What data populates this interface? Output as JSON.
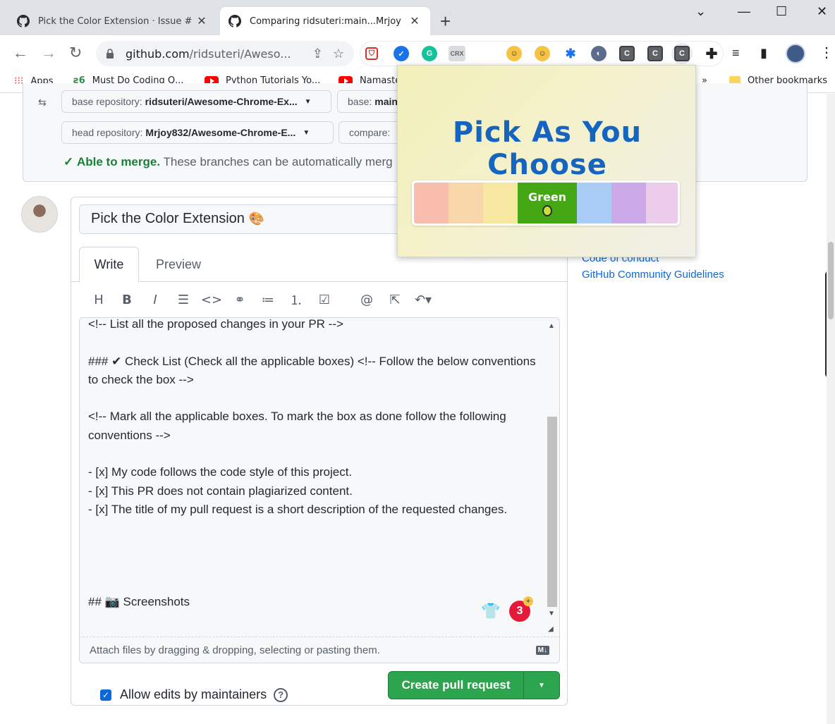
{
  "browser": {
    "tabs": [
      {
        "label": "Pick the Color Extension · Issue #",
        "active": false
      },
      {
        "label": "Comparing ridsuteri:main...Mrjoy",
        "active": true
      }
    ],
    "url_domain": "github.com",
    "url_path": "/ridsuteri/Aweso...",
    "bookmarks": {
      "apps": "Apps",
      "must_do": "Must Do Coding Q...",
      "python": "Python Tutorials Yo...",
      "namaste": "Namaste",
      "overflow": "»",
      "other": "Other bookmarks"
    },
    "ext_crx": "CRX",
    "ext_c": "C"
  },
  "compare": {
    "base_repo_label": "base repository:",
    "base_repo_value": "ridsuteri/Awesome-Chrome-Ex...",
    "base_label": "base:",
    "base_value": "main",
    "head_repo_label": "head repository:",
    "head_repo_value": "Mrjoy832/Awesome-Chrome-E...",
    "compare_label": "compare:",
    "merge_ok": "Able to merge.",
    "merge_text": "These branches can be automatically merg"
  },
  "form": {
    "title_value": "Pick the Color Extension",
    "tab_write": "Write",
    "tab_preview": "Preview",
    "body_lines": [
      "<!-- List all the proposed changes in your PR -->",
      "",
      "### ✔ Check List (Check all the applicable boxes) <!-- Follow the below conventions to check the box -->",
      "",
      "<!-- Mark all the applicable boxes. To mark the box as done follow the following conventions -->",
      "",
      "- [x] My code follows the code style of this project.",
      "- [x] This PR does not contain plagiarized content.",
      "- [x] The title of my pull request is a short description of the requested changes.",
      "",
      "",
      "",
      "",
      "## 📷 Screenshots"
    ],
    "attach_text": "Attach files by dragging & dropping, selecting or pasting them.",
    "allow_edits": "Allow edits by maintainers",
    "allow_edits_checked": true,
    "create_button": "Create pull request",
    "grammar_count": "3"
  },
  "sidebar": {
    "link_1": "Code of conduct",
    "link_2": "GitHub Community Guidelines"
  },
  "popup": {
    "title": "Pick As You Choose",
    "selected_label": "Green",
    "swatches": [
      "#f9bdae",
      "#f9d6a9",
      "#f6e7a1",
      "#43a814",
      "#a9cdf7",
      "#cba9e8",
      "#ebcdeb"
    ]
  }
}
